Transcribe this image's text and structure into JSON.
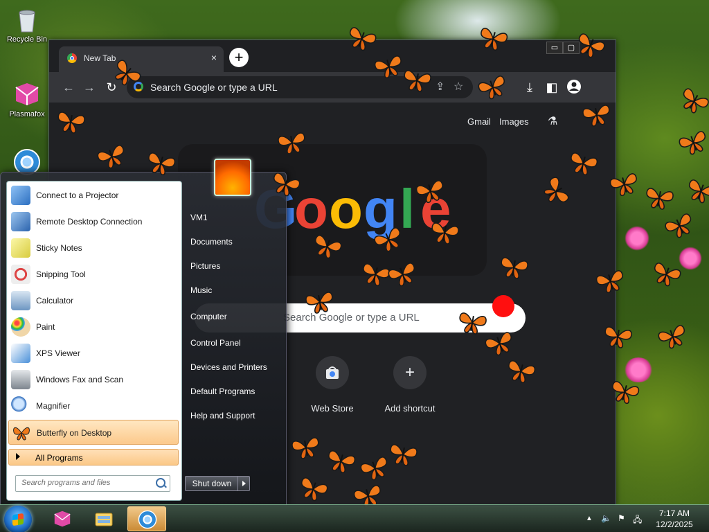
{
  "desktop": {
    "icons": [
      {
        "label": "Recycle Bin",
        "icon": "recycle-bin-icon"
      },
      {
        "label": "Plasmafox",
        "icon": "plasmafox-icon"
      },
      {
        "label": "",
        "icon": "chromium-icon"
      }
    ]
  },
  "browser": {
    "tab_title": "New Tab",
    "tab_close": "×",
    "new_tab": "+",
    "window_controls": [
      "▭",
      "▢"
    ],
    "omnibox_placeholder": "Search Google or type a URL",
    "top_links": [
      "Gmail",
      "Images"
    ],
    "search_placeholder": "Search Google or type a URL",
    "doodle_letters": [
      "G",
      "o",
      "o",
      "g",
      "l",
      "e"
    ],
    "shortcuts": [
      {
        "label": "Web Store",
        "icon": "web-store-icon"
      },
      {
        "label": "Add shortcut",
        "symbol": "+"
      }
    ]
  },
  "start_menu": {
    "programs": [
      {
        "label": "Connect to a Projector",
        "icon": "projector-icon",
        "color": "#3b7bd0"
      },
      {
        "label": "Remote Desktop Connection",
        "icon": "remote-desktop-icon",
        "color": "#2f6fb8"
      },
      {
        "label": "Sticky Notes",
        "icon": "sticky-notes-icon",
        "color": "#e6e26a"
      },
      {
        "label": "Snipping Tool",
        "icon": "scissors-icon",
        "color": "#d23d3d"
      },
      {
        "label": "Calculator",
        "icon": "calculator-icon",
        "color": "#7fa7c9"
      },
      {
        "label": "Paint",
        "icon": "paint-palette-icon",
        "color": "#f0b84a"
      },
      {
        "label": "XPS Viewer",
        "icon": "xps-viewer-icon",
        "color": "#4a90d9"
      },
      {
        "label": "Windows Fax and Scan",
        "icon": "fax-icon",
        "color": "#9aa3ad"
      },
      {
        "label": "Magnifier",
        "icon": "magnifier-icon",
        "color": "#3a7ccf"
      },
      {
        "label": "Butterfly on Desktop",
        "icon": "butterfly-icon",
        "color": "#f07a1a"
      }
    ],
    "all_programs": "All Programs",
    "search_placeholder": "Search programs and files",
    "right_links": [
      "VM1",
      "Documents",
      "Pictures",
      "Music",
      "Computer",
      "Control Panel",
      "Devices and Printers",
      "Default Programs",
      "Help and Support"
    ],
    "shutdown": "Shut down"
  },
  "taskbar": {
    "pinned": [
      "plasmafox-icon",
      "file-explorer-icon",
      "chromium-icon"
    ],
    "time": "7:17 AM",
    "date": "12/2/2025",
    "tray_icons": [
      "show-hidden-icon",
      "volume-muted-icon",
      "action-center-icon",
      "network-icon"
    ]
  },
  "colors": {
    "butterfly_orange": "#f07a1a",
    "browser_bg": "#202124",
    "highlight": "#fcc98b"
  }
}
